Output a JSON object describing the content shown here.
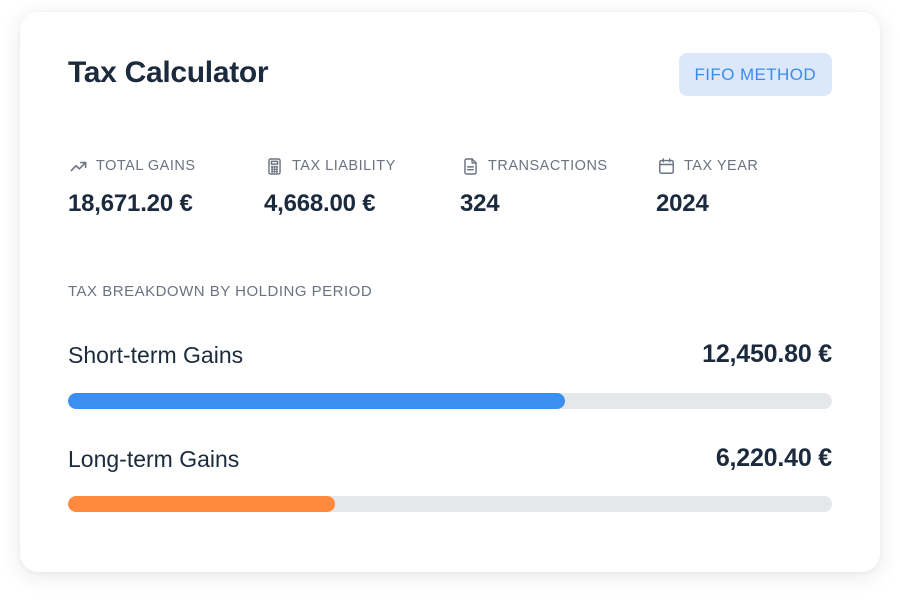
{
  "header": {
    "title": "Tax Calculator",
    "method_badge": "FIFO METHOD"
  },
  "colors": {
    "title_text": "#1b2a3d",
    "badge_bg": "#dbe8fc",
    "badge_text": "#3d8be8",
    "short_term_bar": "#3b8ff0",
    "long_term_bar": "#ff8a3d",
    "bar_track": "#e5e7eb",
    "label_gray": "#6b7280"
  },
  "stats": [
    {
      "icon": "trending-up-icon",
      "label": "TOTAL GAINS",
      "value": "18,671.20 €"
    },
    {
      "icon": "calculator-icon",
      "label": "TAX LIABILITY",
      "value": "4,668.00 €"
    },
    {
      "icon": "document-icon",
      "label": "TRANSACTIONS",
      "value": "324"
    },
    {
      "icon": "calendar-icon",
      "label": "TAX YEAR",
      "value": "2024"
    }
  ],
  "breakdown": {
    "title": "TAX BREAKDOWN BY HOLDING PERIOD",
    "items": [
      {
        "label": "Short-term Gains",
        "value": "12,450.80 €",
        "fraction": 0.65
      },
      {
        "label": "Long-term Gains",
        "value": "6,220.40 €",
        "fraction": 0.35
      }
    ]
  }
}
